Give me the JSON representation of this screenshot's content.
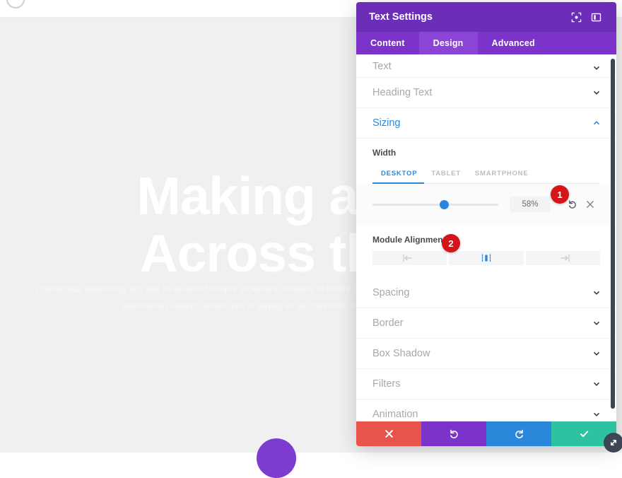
{
  "canvas": {
    "hero_heading_line1": "Making an Impact",
    "hero_heading_line2": "Across the Globe",
    "hero_paragraph": "Consectetur adipisicing elit, sed do eiusmod tempor incididunt ut labore et dolore magna aliqua. Ut enim ad minim veniam, quis nostrud exercitation ullamco laboris nisi ut aliquip ex ea commodo consequat. Duis aute irure dolor.",
    "top_left_icon": "circle-icon",
    "fab_icon": "divi-builder-fab"
  },
  "modal": {
    "title": "Text Settings",
    "header_icons": [
      {
        "name": "expand-fullscreen-icon",
        "glyph": "expand"
      },
      {
        "name": "layout-panel-icon",
        "glyph": "panel"
      }
    ],
    "tabs": [
      {
        "label": "Content",
        "active": false
      },
      {
        "label": "Design",
        "active": true
      },
      {
        "label": "Advanced",
        "active": false
      }
    ],
    "sections_above": [
      {
        "label": "Text",
        "open": false,
        "chevron": "chevron-down-icon"
      },
      {
        "label": "Heading Text",
        "open": false,
        "chevron": "chevron-down-icon"
      }
    ],
    "open_section": {
      "label": "Sizing",
      "open": true,
      "chevron": "chevron-up-icon",
      "width_field": {
        "label": "Width",
        "device_tabs": [
          {
            "label": "DESKTOP",
            "active": true
          },
          {
            "label": "TABLET",
            "active": false
          },
          {
            "label": "SMARTPHONE",
            "active": false
          }
        ],
        "value": "58%",
        "slider_percent": 57,
        "reset_icon": "undo-reset-icon",
        "clear_icon": "close-x-icon"
      },
      "module_alignment": {
        "label": "Module Alignment",
        "options": [
          {
            "name": "align-left-button",
            "icon": "align-left-icon",
            "active": false
          },
          {
            "name": "align-center-button",
            "icon": "align-center-icon",
            "active": true
          },
          {
            "name": "align-right-button",
            "icon": "align-right-icon",
            "active": false
          }
        ]
      }
    },
    "sections_below": [
      {
        "label": "Spacing",
        "open": false,
        "chevron": "chevron-down-icon"
      },
      {
        "label": "Border",
        "open": false,
        "chevron": "chevron-down-icon"
      },
      {
        "label": "Box Shadow",
        "open": false,
        "chevron": "chevron-down-icon"
      },
      {
        "label": "Filters",
        "open": false,
        "chevron": "chevron-down-icon"
      },
      {
        "label": "Animation",
        "open": false,
        "chevron": "chevron-down-icon"
      }
    ],
    "footer_buttons": [
      {
        "name": "discard-button",
        "icon": "close-x-icon",
        "color": "#e8544b"
      },
      {
        "name": "undo-button",
        "icon": "undo-icon",
        "color": "#7b33c9"
      },
      {
        "name": "redo-button",
        "icon": "redo-icon",
        "color": "#2b87da"
      },
      {
        "name": "save-button",
        "icon": "checkmark-icon",
        "color": "#2ec2a0"
      }
    ],
    "resize_handle_icon": "resize-diagonal-icon"
  },
  "annotations": [
    {
      "number": "1",
      "target": "width-slider-row"
    },
    {
      "number": "2",
      "target": "module-alignment-center"
    }
  ],
  "colors": {
    "header_purple": "#6c2eb9",
    "tab_purple": "#7b33c9",
    "tab_active_purple": "#8b45d6",
    "accent_blue": "#2b87da",
    "badge_red": "#d4161a",
    "save_teal": "#2ec2a0",
    "discard_red": "#e8544b"
  }
}
